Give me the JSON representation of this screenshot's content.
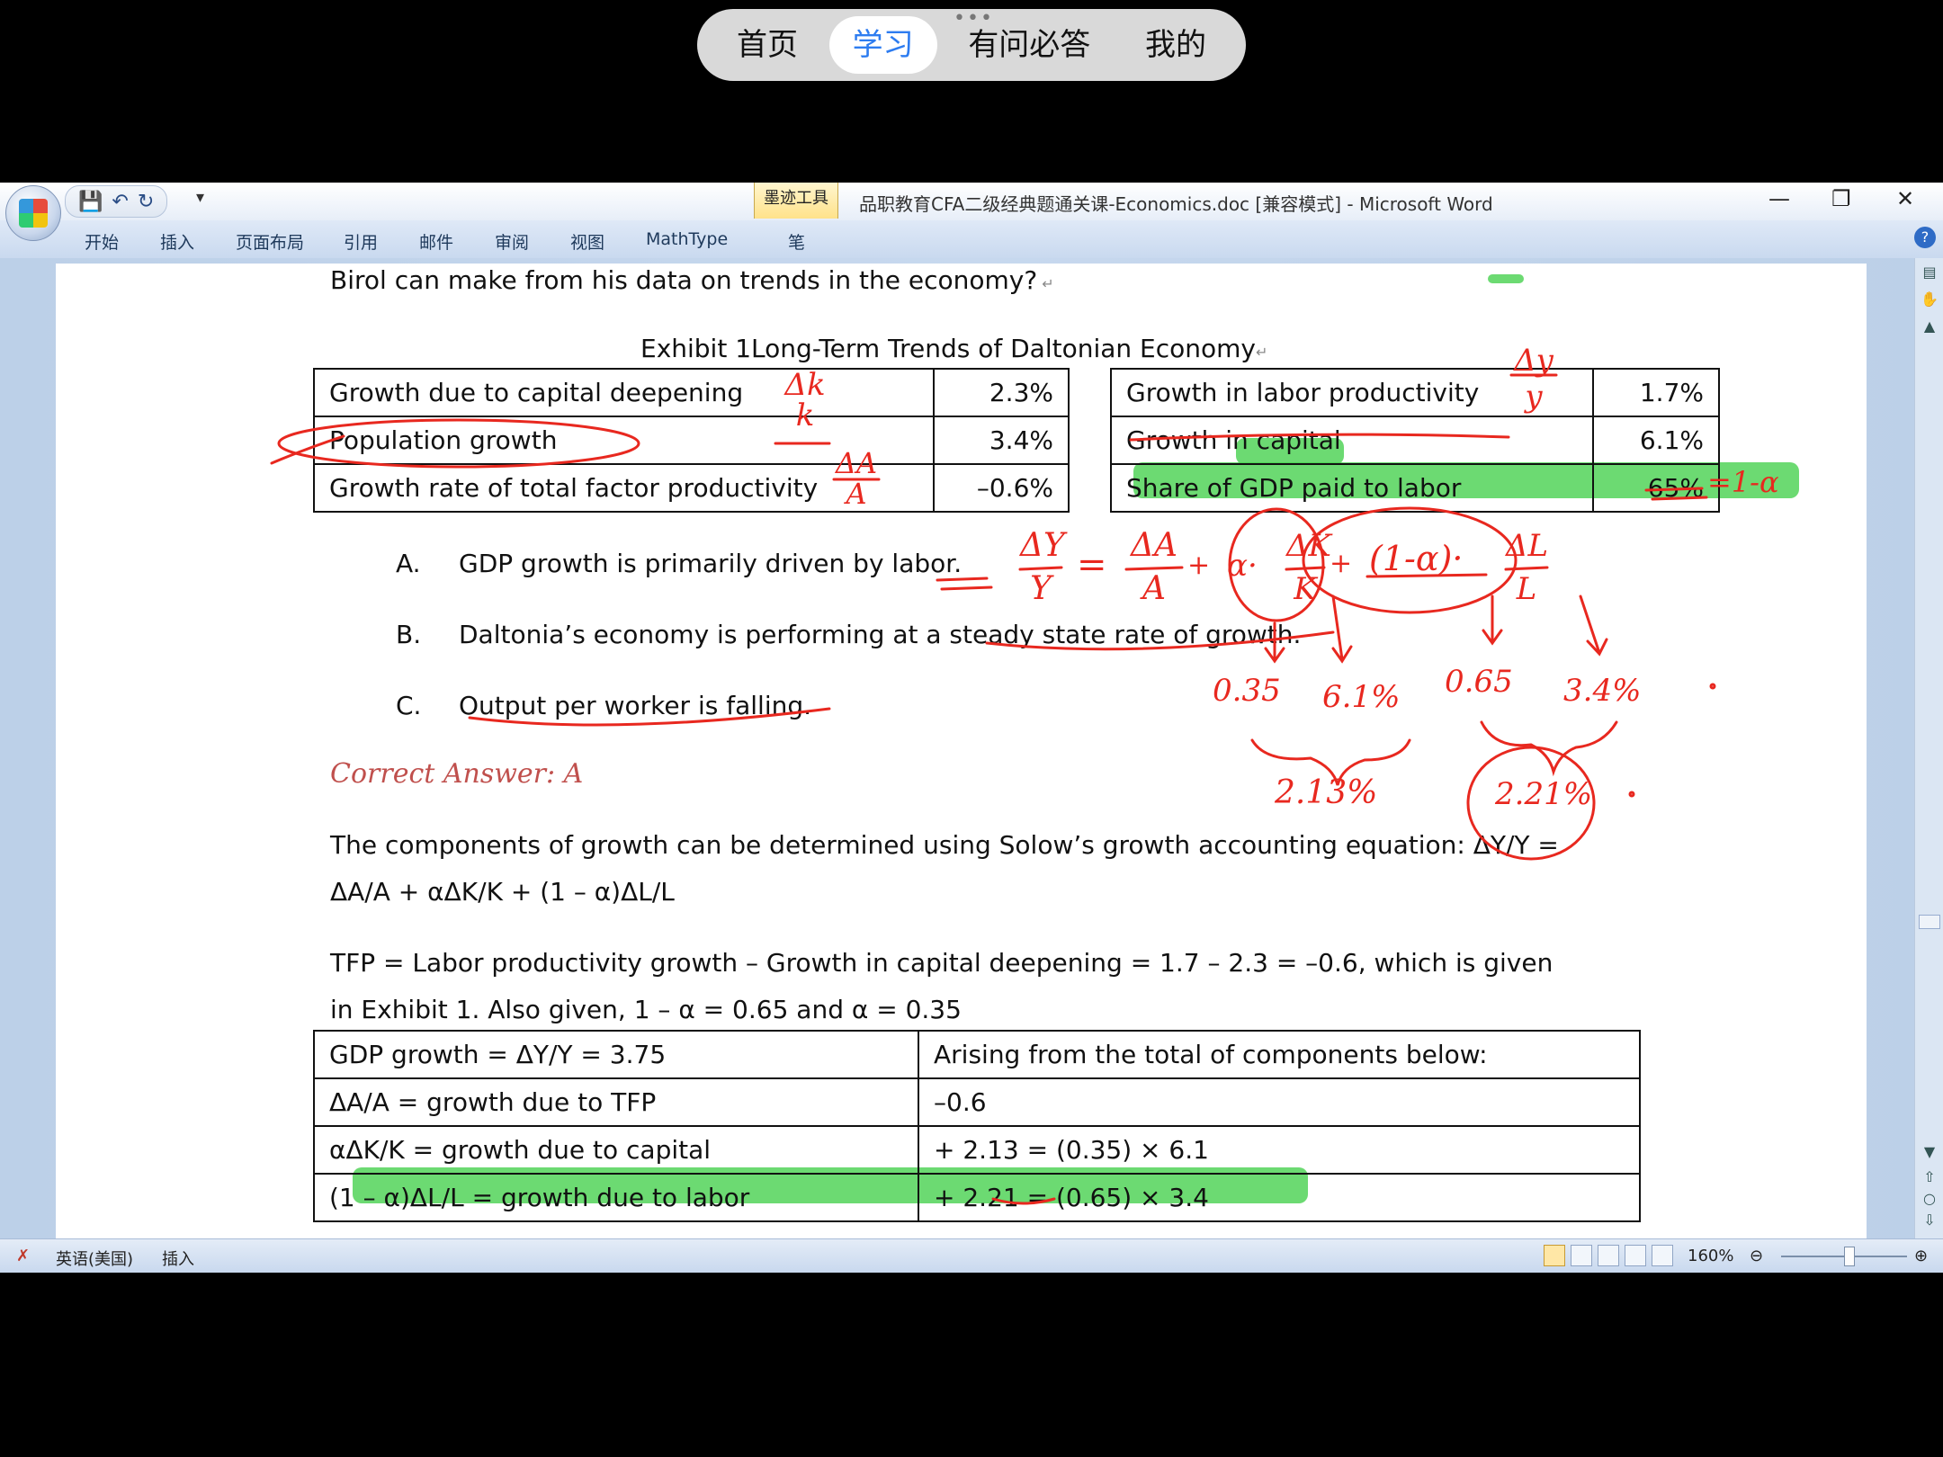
{
  "top_nav": {
    "items": [
      "首页",
      "学习",
      "有问必答",
      "我的"
    ],
    "active": "学习"
  },
  "window": {
    "ink_tools": "墨迹工具",
    "title": "品职教育CFA二级经典题通关课-Economics.doc [兼容模式] - Microsoft Word",
    "ribbon_tabs": [
      "开始",
      "插入",
      "页面布局",
      "引用",
      "邮件",
      "审阅",
      "视图",
      "MathType",
      "笔"
    ]
  },
  "doc": {
    "question_tail": "Birol can make from his data on trends in the economy?",
    "exhibit_title": "Exhibit 1Long-Term Trends of Daltonian Economy",
    "exhibit": {
      "left": [
        {
          "label": "Growth due to capital deepening",
          "value": "2.3%"
        },
        {
          "label": "Population growth",
          "value": "3.4%"
        },
        {
          "label": "Growth rate of total factor productivity",
          "value": "–0.6%"
        }
      ],
      "right": [
        {
          "label": "Growth in labor productivity",
          "value": "1.7%"
        },
        {
          "label": "Growth in capital",
          "value": "6.1%"
        },
        {
          "label": "Share of GDP paid to labor",
          "value": "65%"
        }
      ]
    },
    "options": [
      {
        "letter": "A.",
        "text": "GDP growth is primarily driven by labor."
      },
      {
        "letter": "B.",
        "text": "Daltonia’s economy is performing at a steady state rate of growth."
      },
      {
        "letter": "C.",
        "text": "Output per worker is falling."
      }
    ],
    "correct_answer": "Correct Answer: A",
    "para1_line1": "The components of growth can be determined using Solow’s growth accounting equation: ΔY/Y =",
    "para1_line2": "ΔA/A + αΔK/K + (1 – α)ΔL/L",
    "para2_line1": "TFP = Labor productivity growth – Growth in capital deepening = 1.7 – 2.3 = –0.6, which is given",
    "para2_line2": "in Exhibit 1. Also given, 1 – α = 0.65 and α = 0.35",
    "components": [
      [
        "GDP growth = ΔY/Y = 3.75",
        "Arising from the total of components below:"
      ],
      [
        "ΔA/A = growth due to TFP",
        "–0.6"
      ],
      [
        "αΔK/K    = growth due to capital",
        "+ 2.13 = (0.35) × 6.1"
      ],
      [
        "(1 – α)ΔL/L    = growth due to labor",
        "+ 2.21 = (0.65) × 3.4"
      ]
    ]
  },
  "ink_annotations": {
    "dk_k": [
      "Δk",
      "k"
    ],
    "dy_y": [
      "Δy",
      "y"
    ],
    "da_a": [
      "ΔA",
      "A"
    ],
    "one_minus_alpha": "=1-α",
    "formula": [
      "ΔY",
      "Y",
      "=",
      "ΔA",
      "A",
      "+",
      "α·",
      "ΔK",
      "K",
      "+",
      "(1-α)·",
      "ΔL",
      "L"
    ],
    "values": [
      "0.35",
      "6.1%",
      "0.65",
      "3.4%",
      "2.13%",
      "2.21%"
    ]
  },
  "statusbar": {
    "language": "英语(美国)",
    "mode": "插入",
    "zoom": "160%"
  }
}
